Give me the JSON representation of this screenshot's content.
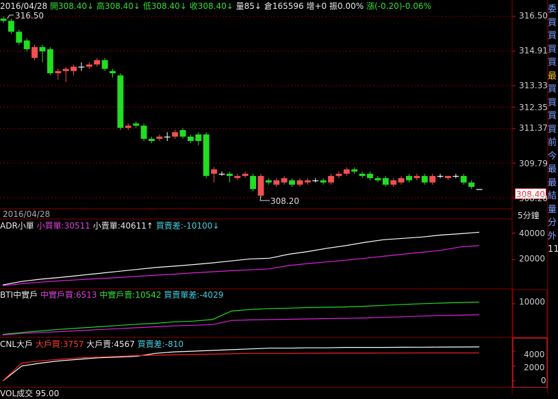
{
  "header": {
    "date": "2016/04/28",
    "open_label": "開",
    "open": "308.40",
    "high_label": "高",
    "high": "308.40",
    "low_label": "低",
    "low": "308.40",
    "close_label": "收",
    "close": "308.40",
    "vol_label": "量",
    "vol": "85",
    "oi_label": "倉",
    "oi": "165596",
    "inc_label": "增",
    "inc": "+0",
    "amp_label": "振",
    "amp": "0.00%",
    "chg_label": "漲",
    "chg": "(-0.20)-0.06%",
    "arrow_down": "↓"
  },
  "price_panel": {
    "high_note": "316.50",
    "low_note": "308.20",
    "last_price_tag": "308.40",
    "date_bar": "2016/04/28",
    "period": "5分鐘",
    "y_labels": [
      "316.50",
      "314.91",
      "313.33",
      "312.35",
      "311.37",
      "309.79",
      "308.20"
    ]
  },
  "panel_adr": {
    "name": "ADR小單",
    "s1_label": "小買單:",
    "s1_value": "30511",
    "s2_label": "小賣單:",
    "s2_value": "40611",
    "up_arrow": "↑",
    "s3_label": "買賣差:",
    "s3_value": "-10100",
    "down_arrow": "↓",
    "y_labels": [
      "40000",
      "20000"
    ]
  },
  "panel_bti": {
    "name": "BTI中實戶",
    "s1_label": "中實戶買:",
    "s1_value": "6513",
    "s2_label": "中實戶賣:",
    "s2_value": "10542",
    "s3_label": "買賣單差:",
    "s3_value": "-4029",
    "y_labels": [
      "10000"
    ]
  },
  "panel_cnl": {
    "name": "CNL大戶",
    "s1_label": "大戶買:",
    "s1_value": "3757",
    "s2_label": "大戶賣:",
    "s2_value": "4567",
    "s3_label": "買賣差:",
    "s3_value": "-810",
    "y_labels": [
      "4000",
      "2000",
      "0"
    ]
  },
  "panel_vol": {
    "name": "VOL成交",
    "value": "95.00"
  },
  "sidebar": {
    "chars": [
      "委",
      "買",
      "買",
      "買",
      "買",
      "最",
      "買",
      "買",
      "買",
      "買",
      "前",
      "今",
      "最",
      "最",
      "結",
      "量",
      "分",
      "外",
      "11"
    ]
  },
  "colors": {
    "up": "#f05050",
    "down": "#22dd22",
    "grid": "#8b0000",
    "white_line": "#ffffff",
    "magenta_line": "#dd22dd",
    "green_line": "#22dd22",
    "red_line": "#ff2020"
  },
  "chart_data": [
    {
      "type": "candlestick",
      "title": "",
      "ylim": [
        308.2,
        316.5
      ],
      "y_ticks": [
        316.5,
        314.91,
        313.33,
        312.35,
        311.37,
        309.79,
        308.2
      ],
      "candles": [
        [
          316.4,
          316.3,
          316.5,
          316.2
        ],
        [
          316.3,
          315.8,
          316.4,
          315.7
        ],
        [
          315.8,
          315.3,
          315.9,
          315.2
        ],
        [
          315.4,
          315.0,
          315.5,
          314.9
        ],
        [
          314.6,
          315.1,
          315.2,
          314.5
        ],
        [
          315.1,
          314.9,
          315.2,
          314.4
        ],
        [
          315.0,
          313.9,
          315.1,
          313.8
        ],
        [
          313.9,
          314.0,
          314.1,
          313.6
        ],
        [
          314.0,
          314.1,
          314.2,
          313.5
        ],
        [
          314.0,
          314.2,
          314.3,
          313.8
        ],
        [
          314.2,
          314.2,
          314.4,
          314.0
        ],
        [
          314.2,
          314.3,
          314.4,
          314.1
        ],
        [
          314.3,
          314.5,
          314.6,
          314.2
        ],
        [
          314.5,
          314.1,
          314.6,
          314.0
        ],
        [
          314.0,
          313.9,
          314.1,
          313.7
        ],
        [
          313.8,
          311.4,
          313.9,
          311.3
        ],
        [
          311.4,
          311.5,
          311.6,
          311.3
        ],
        [
          311.6,
          311.5,
          311.7,
          311.4
        ],
        [
          311.5,
          310.9,
          311.6,
          310.8
        ],
        [
          310.9,
          310.8,
          311.0,
          310.7
        ],
        [
          310.9,
          311.0,
          311.1,
          310.8
        ],
        [
          311.0,
          311.0,
          311.2,
          310.8
        ],
        [
          311.0,
          311.2,
          311.3,
          310.9
        ],
        [
          311.3,
          311.0,
          311.4,
          310.9
        ],
        [
          311.0,
          310.8,
          311.1,
          310.7
        ],
        [
          311.1,
          310.8,
          311.2,
          310.6
        ],
        [
          311.1,
          309.2,
          311.2,
          309.1
        ],
        [
          309.3,
          309.5,
          309.6,
          308.9
        ],
        [
          309.3,
          309.3,
          309.4,
          309.2
        ],
        [
          309.3,
          309.2,
          309.4,
          308.9
        ],
        [
          309.1,
          309.2,
          309.3,
          309.0
        ],
        [
          309.2,
          309.3,
          309.4,
          309.1
        ],
        [
          309.2,
          308.6,
          309.3,
          308.5
        ],
        [
          308.3,
          309.2,
          309.3,
          308.2
        ],
        [
          309.0,
          308.9,
          309.1,
          308.8
        ],
        [
          308.8,
          309.0,
          309.1,
          308.7
        ],
        [
          308.9,
          309.1,
          309.2,
          308.8
        ],
        [
          309.0,
          308.8,
          309.1,
          308.7
        ],
        [
          308.8,
          309.0,
          309.1,
          308.7
        ],
        [
          308.9,
          309.0,
          309.1,
          308.8
        ],
        [
          309.0,
          309.0,
          309.1,
          308.9
        ],
        [
          309.0,
          308.9,
          309.1,
          308.8
        ],
        [
          308.9,
          309.2,
          309.3,
          308.8
        ],
        [
          309.2,
          309.3,
          309.4,
          309.1
        ],
        [
          309.3,
          309.5,
          309.6,
          309.2
        ],
        [
          309.5,
          309.4,
          309.6,
          309.3
        ],
        [
          309.3,
          309.2,
          309.4,
          309.1
        ],
        [
          309.3,
          309.1,
          309.4,
          309.0
        ],
        [
          309.1,
          309.0,
          309.2,
          308.9
        ],
        [
          309.1,
          308.8,
          309.2,
          308.7
        ],
        [
          308.8,
          309.0,
          309.1,
          308.7
        ],
        [
          308.9,
          309.1,
          309.2,
          308.8
        ],
        [
          309.2,
          309.0,
          309.3,
          308.9
        ],
        [
          309.1,
          309.2,
          309.3,
          309.0
        ],
        [
          309.2,
          308.9,
          309.3,
          308.8
        ],
        [
          308.9,
          309.2,
          309.3,
          308.8
        ],
        [
          309.2,
          309.2,
          309.3,
          309.1
        ],
        [
          309.1,
          309.2,
          309.2,
          309.0
        ],
        [
          309.2,
          309.2,
          309.3,
          309.1
        ],
        [
          309.2,
          308.9,
          309.3,
          308.8
        ],
        [
          308.9,
          308.7,
          309.0,
          308.6
        ],
        [
          308.6,
          308.6,
          308.6,
          308.6
        ]
      ]
    },
    {
      "type": "line",
      "title": "ADR小單",
      "ylim": [
        0,
        48000
      ],
      "series": [
        {
          "name": "小賣單",
          "values": [
            900,
            3500,
            5200,
            6500,
            8000,
            9500,
            11000,
            12500,
            14000,
            15000,
            16200,
            17500,
            19000,
            20500,
            21000,
            24000,
            26000,
            28500,
            30500,
            33000,
            35000,
            36000,
            37000,
            38500,
            39500,
            40611
          ]
        },
        {
          "name": "小買單",
          "values": [
            300,
            1800,
            3000,
            3900,
            4800,
            5600,
            6400,
            7300,
            8200,
            9000,
            10000,
            10800,
            11600,
            12300,
            13000,
            15500,
            17000,
            18200,
            19500,
            21000,
            22500,
            24000,
            25500,
            27000,
            29500,
            30511
          ]
        }
      ]
    },
    {
      "type": "line",
      "title": "BTI中實戶",
      "ylim": [
        0,
        13000
      ],
      "series": [
        {
          "name": "中實戶賣",
          "values": [
            300,
            900,
            1400,
            1900,
            2300,
            2700,
            3100,
            3500,
            3800,
            4300,
            4500,
            5000,
            7700,
            8200,
            8500,
            8600,
            8800,
            8900,
            9000,
            9200,
            9500,
            9800,
            10000,
            10200,
            10400,
            10542
          ]
        },
        {
          "name": "中實戶買",
          "values": [
            100,
            600,
            900,
            1200,
            1500,
            1800,
            2100,
            2400,
            2700,
            3000,
            3200,
            3400,
            4700,
            4900,
            5000,
            5100,
            5200,
            5300,
            5400,
            5500,
            5700,
            5900,
            6100,
            6300,
            6400,
            6513
          ]
        }
      ]
    },
    {
      "type": "line",
      "title": "CNL大戶",
      "ylim": [
        -500,
        5200
      ],
      "series": [
        {
          "name": "大戶賣",
          "values": [
            0,
            2000,
            2400,
            2700,
            2900,
            3100,
            3200,
            3300,
            3700,
            3900,
            4000,
            4100,
            4200,
            4300,
            4400,
            4400,
            4450,
            4450,
            4500,
            4500,
            4500,
            4520,
            4530,
            4550,
            4560,
            4567
          ]
        },
        {
          "name": "大戶買",
          "values": [
            0,
            2400,
            2700,
            2900,
            3100,
            3200,
            3300,
            3400,
            3450,
            3500,
            3550,
            3600,
            3650,
            3700,
            3700,
            3700,
            3720,
            3730,
            3740,
            3740,
            3750,
            3750,
            3755,
            3757,
            3757,
            3757
          ]
        }
      ]
    }
  ]
}
